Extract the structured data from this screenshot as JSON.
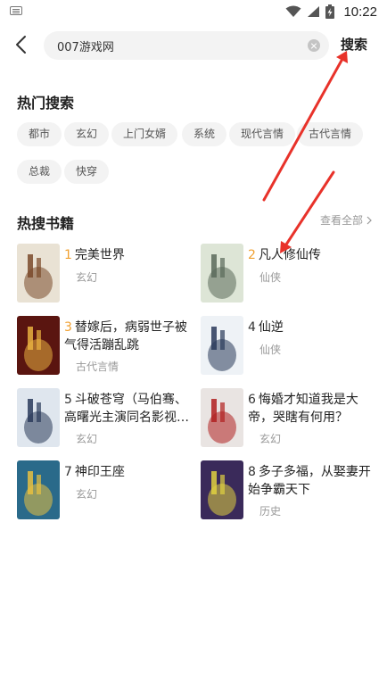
{
  "status_bar": {
    "time": "10:22"
  },
  "search": {
    "query": "007游戏网",
    "button_label": "搜索"
  },
  "hot_search": {
    "title": "热门搜索",
    "tags": [
      "都市",
      "玄幻",
      "上门女婿",
      "系统",
      "现代言情",
      "古代言情",
      "总裁",
      "快穿"
    ]
  },
  "hot_books": {
    "title": "热搜书籍",
    "view_all": "查看全部",
    "books": [
      {
        "rank": "1",
        "title": "完美世界",
        "genre": "玄幻",
        "cover_color": "#e9e2d4",
        "cover_accent": "#7a4a2a"
      },
      {
        "rank": "2",
        "title": "凡人修仙传",
        "genre": "仙侠",
        "cover_color": "#dde5d6",
        "cover_accent": "#5a6a5a"
      },
      {
        "rank": "3",
        "title": "替嫁后，病弱世子被气得活蹦乱跳",
        "genre": "古代言情",
        "cover_color": "#5a1510",
        "cover_accent": "#e8b040"
      },
      {
        "rank": "4",
        "title": "仙逆",
        "genre": "仙侠",
        "cover_color": "#eef2f6",
        "cover_accent": "#2a3a5a"
      },
      {
        "rank": "5",
        "title": "斗破苍穹（马伯骞、高曙光主演同名影视剧原著）",
        "genre": "玄幻",
        "cover_color": "#dfe6ee",
        "cover_accent": "#2a3a5a"
      },
      {
        "rank": "6",
        "title": "悔婚才知道我是大帝，哭瞎有何用？",
        "genre": "玄幻",
        "cover_color": "#e9e4e2",
        "cover_accent": "#b02020"
      },
      {
        "rank": "7",
        "title": "神印王座",
        "genre": "玄幻",
        "cover_color": "#2a6a8a",
        "cover_accent": "#e8c040"
      },
      {
        "rank": "8",
        "title": "多子多福，从娶妻开始争霸天下",
        "genre": "历史",
        "cover_color": "#3a2a5a",
        "cover_accent": "#e0d040"
      }
    ]
  },
  "colors": {
    "accent_rank": "#f0a030",
    "tag_bg": "#f3f3f3",
    "annotation_arrow": "#e8322a"
  }
}
